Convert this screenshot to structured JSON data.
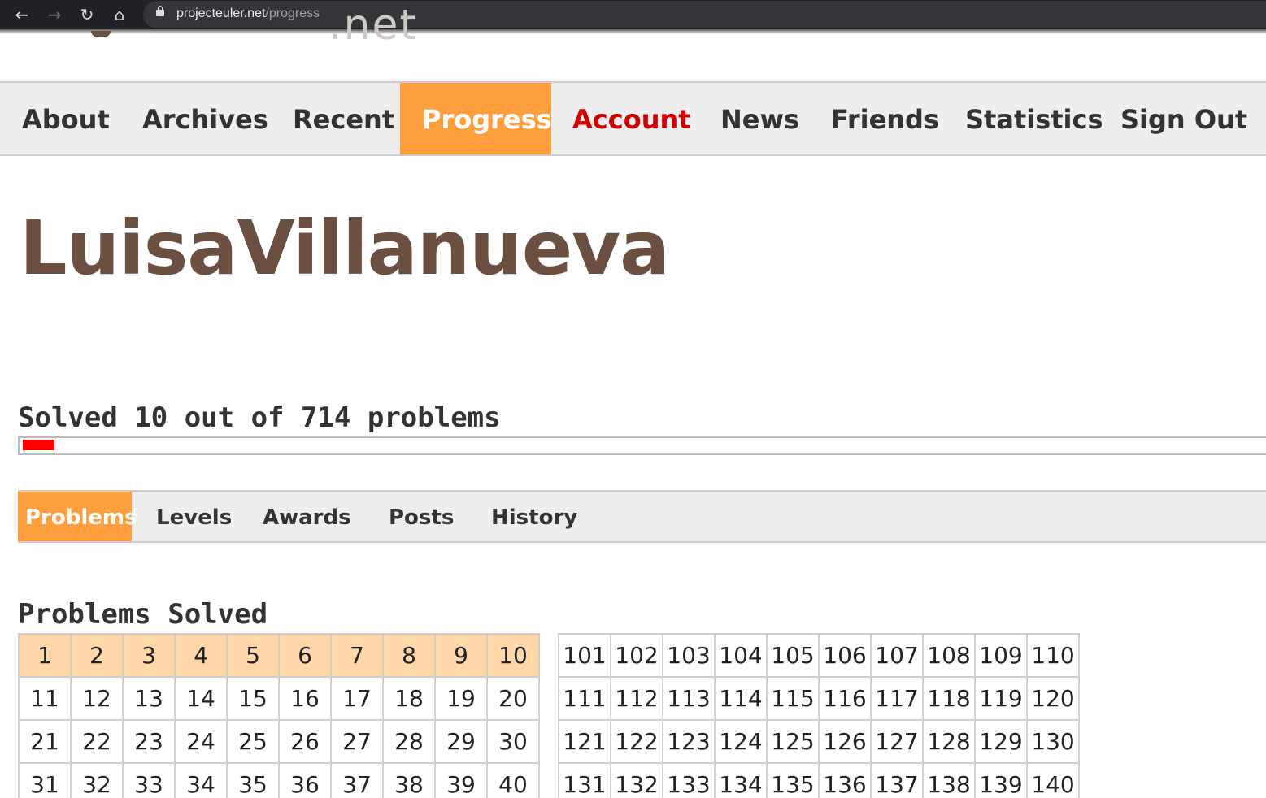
{
  "browser": {
    "url_host": "projecteuler.net",
    "url_path": "/progress"
  },
  "logo": {
    "partial_text": ".net"
  },
  "nav": {
    "items": [
      {
        "label": "About"
      },
      {
        "label": "Archives"
      },
      {
        "label": "Recent"
      },
      {
        "label": "Progress",
        "active": true
      },
      {
        "label": "Account"
      },
      {
        "label": "News"
      },
      {
        "label": "Friends"
      },
      {
        "label": "Statistics"
      },
      {
        "label": "Sign Out"
      }
    ]
  },
  "profile": {
    "username": "LuisaVillanueva",
    "solved_text": "Solved 10 out of 714 problems",
    "solved": 10,
    "total": 714
  },
  "subnav": {
    "items": [
      {
        "label": "Problems",
        "active": true
      },
      {
        "label": "Levels"
      },
      {
        "label": "Awards"
      },
      {
        "label": "Posts"
      },
      {
        "label": "History"
      }
    ]
  },
  "problems": {
    "title": "Problems Solved",
    "solved_ids": [
      1,
      2,
      3,
      4,
      5,
      6,
      7,
      8,
      9,
      10
    ],
    "grids": [
      [
        [
          "1",
          "2",
          "3",
          "4",
          "5",
          "6",
          "7",
          "8",
          "9",
          "10"
        ],
        [
          "11",
          "12",
          "13",
          "14",
          "15",
          "16",
          "17",
          "18",
          "19",
          "20"
        ],
        [
          "21",
          "22",
          "23",
          "24",
          "25",
          "26",
          "27",
          "28",
          "29",
          "30"
        ],
        [
          "31",
          "32",
          "33",
          "34",
          "35",
          "36",
          "37",
          "38",
          "39",
          "40"
        ]
      ],
      [
        [
          "101",
          "102",
          "103",
          "104",
          "105",
          "106",
          "107",
          "108",
          "109",
          "110"
        ],
        [
          "111",
          "112",
          "113",
          "114",
          "115",
          "116",
          "117",
          "118",
          "119",
          "120"
        ],
        [
          "121",
          "122",
          "123",
          "124",
          "125",
          "126",
          "127",
          "128",
          "129",
          "130"
        ],
        [
          "131",
          "132",
          "133",
          "134",
          "135",
          "136",
          "137",
          "138",
          "139",
          "140"
        ]
      ]
    ]
  },
  "colors": {
    "accent": "#ff9e3d",
    "account": "#cc0000",
    "username": "#6b4f41",
    "progress": "#ff0000",
    "solved_cell": "#ffd7a8"
  }
}
